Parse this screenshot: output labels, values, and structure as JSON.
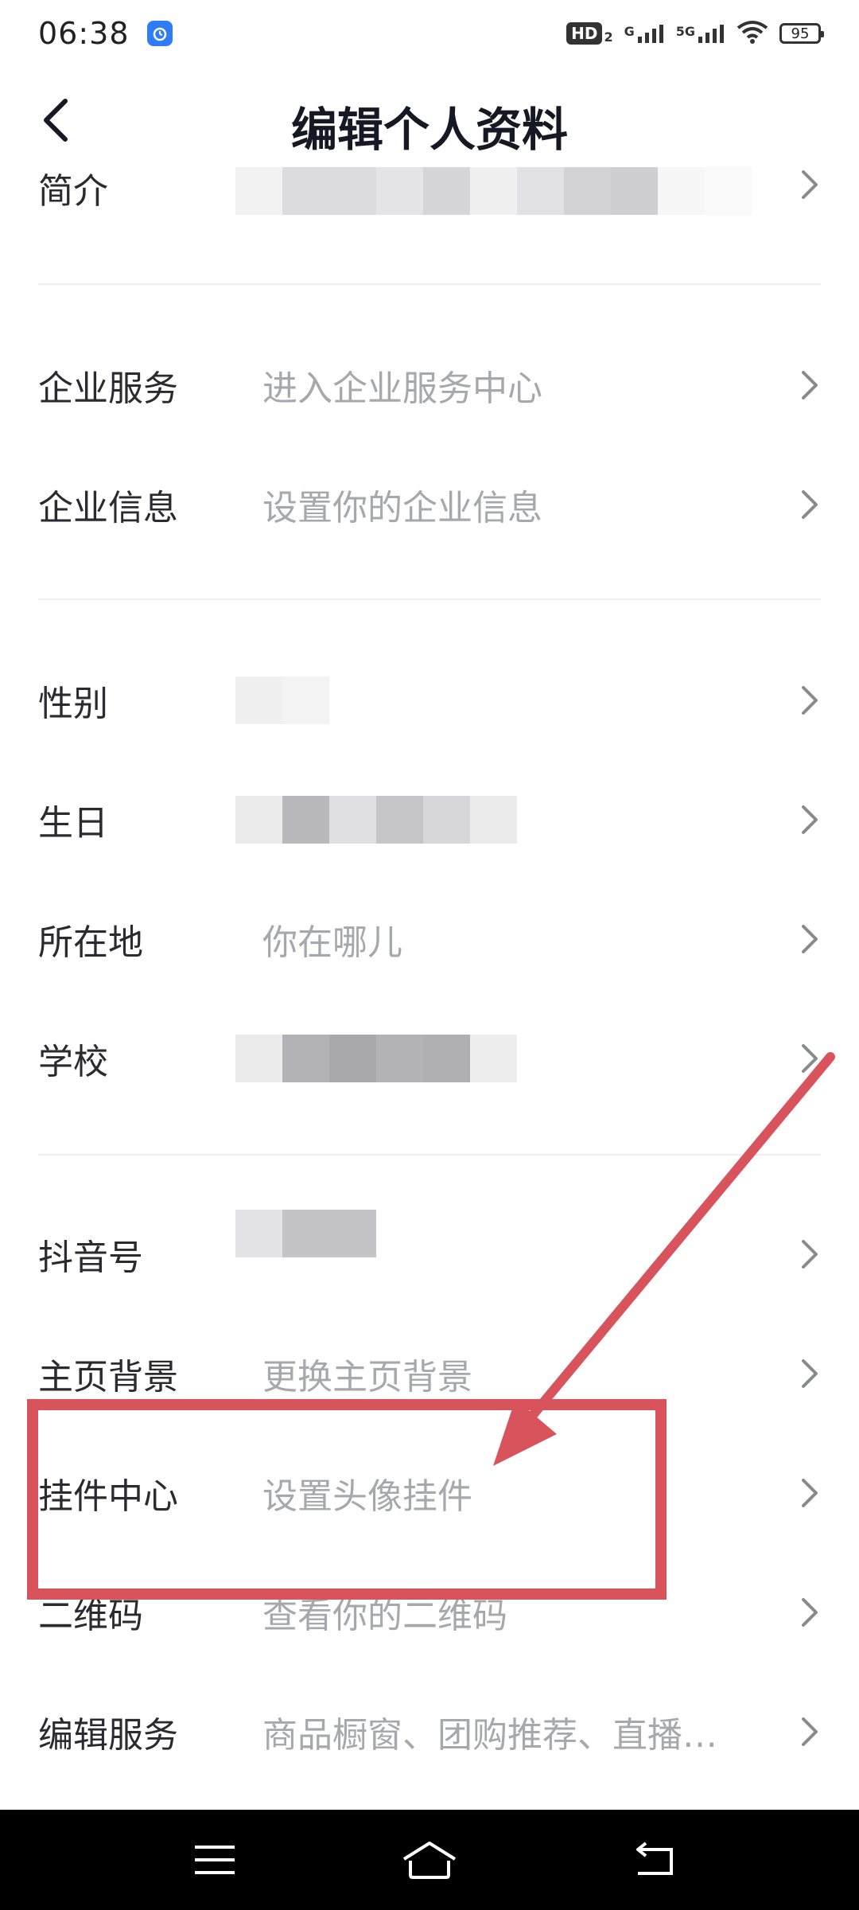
{
  "status_bar": {
    "time": "06:38",
    "hd_label": "HD",
    "sim2_label": "2",
    "net1_label": "G",
    "net2_label": "5G",
    "battery": "95"
  },
  "header": {
    "title": "编辑个人资料"
  },
  "rows": [
    {
      "label": "简介",
      "value": ""
    },
    {
      "label": "企业服务",
      "value": "进入企业服务中心"
    },
    {
      "label": "企业信息",
      "value": "设置你的企业信息"
    },
    {
      "label": "性别",
      "value": ""
    },
    {
      "label": "生日",
      "value": ""
    },
    {
      "label": "所在地",
      "value": "你在哪儿"
    },
    {
      "label": "学校",
      "value": ""
    },
    {
      "label": "抖音号",
      "value": ""
    },
    {
      "label": "主页背景",
      "value": "更换主页背景"
    },
    {
      "label": "挂件中心",
      "value": "设置头像挂件"
    },
    {
      "label": "二维码",
      "value": "查看你的二维码"
    },
    {
      "label": "编辑服务",
      "value": "商品橱窗、团购推荐、直播…"
    }
  ],
  "colors": {
    "annotation": "#d9535d",
    "label_text": "#2a2a30",
    "value_text": "#a7a8ad",
    "divider": "#eeeeef"
  },
  "icons": {
    "back": "chevron-left-icon",
    "row_arrow": "chevron-right-icon",
    "nav_menu": "menu-icon",
    "nav_home": "home-icon",
    "nav_back": "back-icon"
  }
}
